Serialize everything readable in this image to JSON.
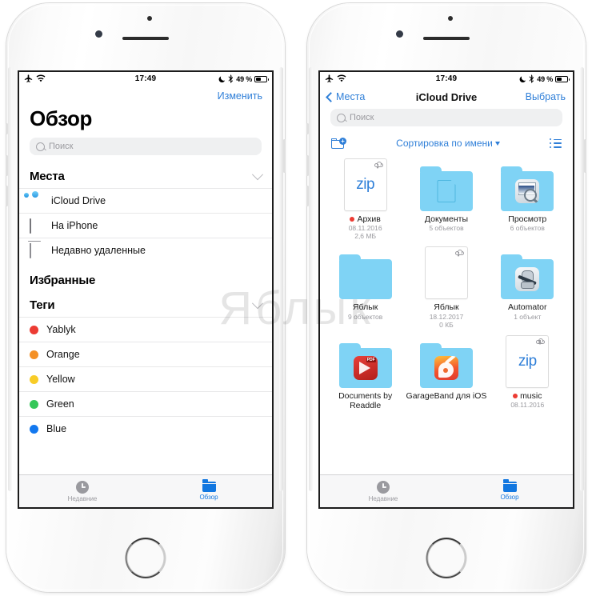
{
  "status_bar": {
    "airplane_icon": "airplane-icon",
    "wifi_icon": "wifi-icon",
    "time": "17:49",
    "dnd_icon": "moon-icon",
    "bluetooth_icon": "bluetooth-icon",
    "battery_percent": "49 %",
    "battery_icon": "battery-icon"
  },
  "left_phone": {
    "edit_button": "Изменить",
    "title": "Обзор",
    "search_placeholder": "Поиск",
    "sections": [
      {
        "title": "Места",
        "collapsible": true,
        "rows": [
          {
            "label": "iCloud Drive",
            "icon": "icloud-icon"
          },
          {
            "label": "На iPhone",
            "icon": "iphone-icon"
          },
          {
            "label": "Недавно удаленные",
            "icon": "trash-icon"
          }
        ]
      },
      {
        "title": "Избранные",
        "collapsible": false,
        "rows": []
      },
      {
        "title": "Теги",
        "collapsible": true,
        "rows": [
          {
            "label": "Yablyk",
            "color": "#ec3b33"
          },
          {
            "label": "Orange",
            "color": "#f49026"
          },
          {
            "label": "Yellow",
            "color": "#f8cc27"
          },
          {
            "label": "Green",
            "color": "#35c759"
          },
          {
            "label": "Blue",
            "color": "#1278ef"
          }
        ]
      }
    ],
    "tabs": [
      {
        "label": "Недавние",
        "icon": "clock-icon",
        "active": false
      },
      {
        "label": "Обзор",
        "icon": "folder-icon",
        "active": true
      }
    ]
  },
  "right_phone": {
    "back_label": "Места",
    "nav_title": "iCloud Drive",
    "select_button": "Выбрать",
    "search_placeholder": "Поиск",
    "toolbar": {
      "new_folder_icon": "new-folder-icon",
      "sort_label": "Сортировка по имени",
      "sort_caret": "▾",
      "list_view_icon": "list-view-icon"
    },
    "files": [
      {
        "kind": "zip",
        "name": "Архив",
        "tag": "#ec3b33",
        "line2": "08.11.2016",
        "line3": "2,6 МБ",
        "cloud": true
      },
      {
        "kind": "folder",
        "name": "Документы",
        "glyph": "document-glyph",
        "line2": "5 объектов",
        "line3": ""
      },
      {
        "kind": "folder",
        "name": "Просмотр",
        "glyph": "preview-app-icon",
        "line2": "6 объектов",
        "line3": ""
      },
      {
        "kind": "folder",
        "name": "Яблык",
        "glyph": "",
        "line2": "9 объектов",
        "line3": ""
      },
      {
        "kind": "blank",
        "name": "Яблык",
        "line2": "18.12.2017",
        "line3": "0 КБ",
        "cloud": true
      },
      {
        "kind": "folder",
        "name": "Automator",
        "glyph": "automator-app-icon",
        "line2": "1 объект",
        "line3": ""
      },
      {
        "kind": "folder",
        "name": "Documents by Readdle",
        "glyph": "pdf-app-icon",
        "line2": "",
        "line3": ""
      },
      {
        "kind": "folder",
        "name": "GarageBand для iOS",
        "glyph": "garageband-app-icon",
        "line2": "",
        "line3": ""
      },
      {
        "kind": "zip",
        "name": "music",
        "tag": "#ec3b33",
        "line2": "08.11.2016",
        "line3": "",
        "cloud": true
      }
    ],
    "tabs": [
      {
        "label": "Недавние",
        "icon": "clock-icon",
        "active": false
      },
      {
        "label": "Обзор",
        "icon": "folder-icon",
        "active": true
      }
    ]
  },
  "watermark": {
    "text": "Яблык"
  },
  "colors": {
    "accent_blue": "#2f7fd8",
    "tab_active": "#1277e0",
    "folder_blue": "#7fd3f5",
    "muted": "#9a9a9f"
  }
}
